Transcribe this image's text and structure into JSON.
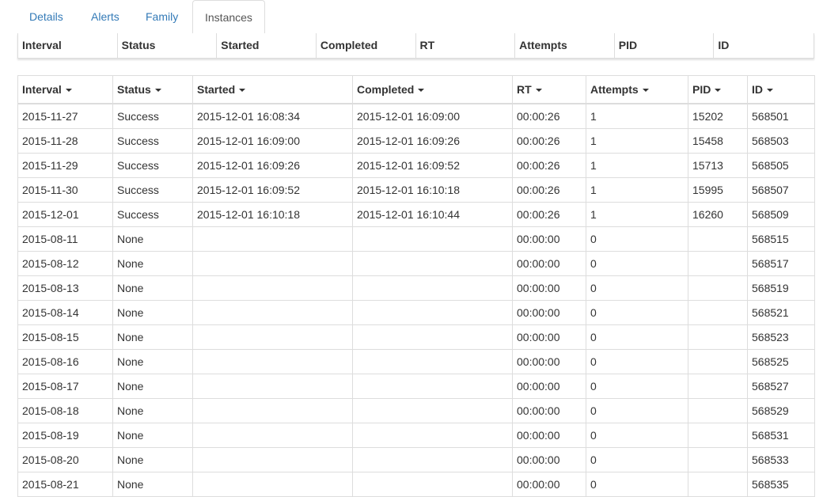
{
  "tabs": [
    {
      "label": "Details"
    },
    {
      "label": "Alerts"
    },
    {
      "label": "Family"
    },
    {
      "label": "Instances"
    }
  ],
  "active_tab": "Instances",
  "columns": [
    "Interval",
    "Status",
    "Started",
    "Completed",
    "RT",
    "Attempts",
    "PID",
    "ID"
  ],
  "sort_icon": "caret-down-icon",
  "rows": [
    [
      "2015-11-27",
      "Success",
      "2015-12-01 16:08:34",
      "2015-12-01 16:09:00",
      "00:00:26",
      "1",
      "15202",
      "568501"
    ],
    [
      "2015-11-28",
      "Success",
      "2015-12-01 16:09:00",
      "2015-12-01 16:09:26",
      "00:00:26",
      "1",
      "15458",
      "568503"
    ],
    [
      "2015-11-29",
      "Success",
      "2015-12-01 16:09:26",
      "2015-12-01 16:09:52",
      "00:00:26",
      "1",
      "15713",
      "568505"
    ],
    [
      "2015-11-30",
      "Success",
      "2015-12-01 16:09:52",
      "2015-12-01 16:10:18",
      "00:00:26",
      "1",
      "15995",
      "568507"
    ],
    [
      "2015-12-01",
      "Success",
      "2015-12-01 16:10:18",
      "2015-12-01 16:10:44",
      "00:00:26",
      "1",
      "16260",
      "568509"
    ],
    [
      "2015-08-11",
      "None",
      "",
      "",
      "00:00:00",
      "0",
      "",
      "568515"
    ],
    [
      "2015-08-12",
      "None",
      "",
      "",
      "00:00:00",
      "0",
      "",
      "568517"
    ],
    [
      "2015-08-13",
      "None",
      "",
      "",
      "00:00:00",
      "0",
      "",
      "568519"
    ],
    [
      "2015-08-14",
      "None",
      "",
      "",
      "00:00:00",
      "0",
      "",
      "568521"
    ],
    [
      "2015-08-15",
      "None",
      "",
      "",
      "00:00:00",
      "0",
      "",
      "568523"
    ],
    [
      "2015-08-16",
      "None",
      "",
      "",
      "00:00:00",
      "0",
      "",
      "568525"
    ],
    [
      "2015-08-17",
      "None",
      "",
      "",
      "00:00:00",
      "0",
      "",
      "568527"
    ],
    [
      "2015-08-18",
      "None",
      "",
      "",
      "00:00:00",
      "0",
      "",
      "568529"
    ],
    [
      "2015-08-19",
      "None",
      "",
      "",
      "00:00:00",
      "0",
      "",
      "568531"
    ],
    [
      "2015-08-20",
      "None",
      "",
      "",
      "00:00:00",
      "0",
      "",
      "568533"
    ],
    [
      "2015-08-21",
      "None",
      "",
      "",
      "00:00:00",
      "0",
      "",
      "568535"
    ]
  ]
}
